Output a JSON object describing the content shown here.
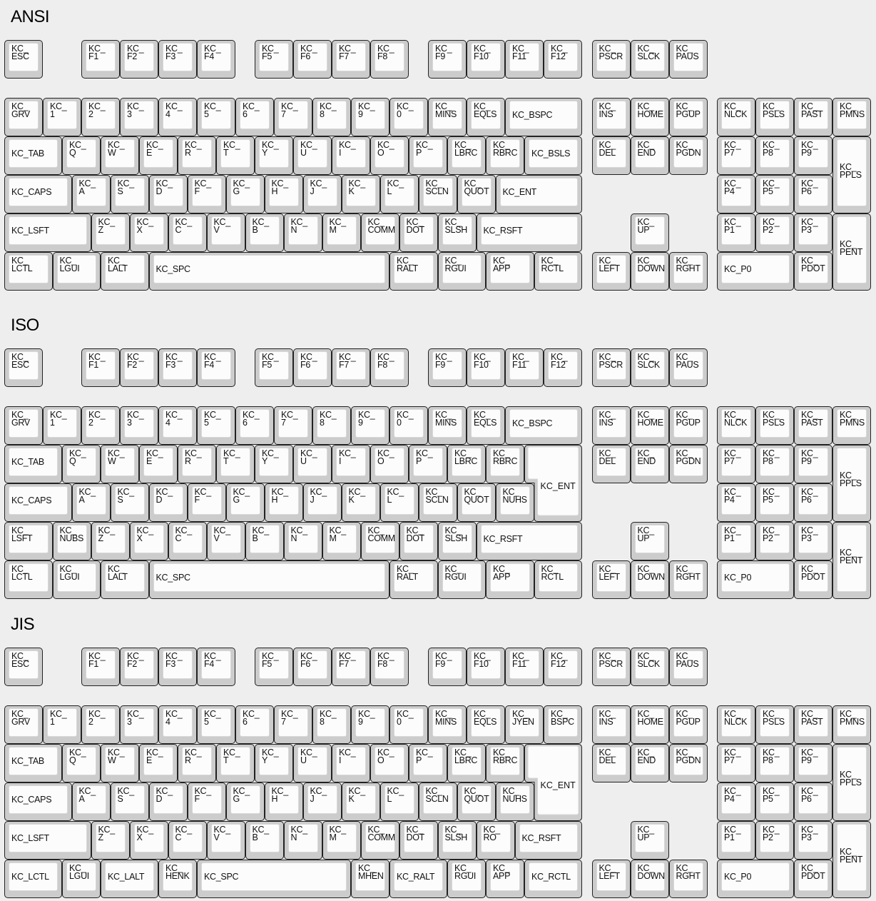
{
  "sections": [
    {
      "title": "ANSI",
      "layout": "ansi",
      "frow": [
        "KC_ESC",
        "KC_F1",
        "KC_F2",
        "KC_F3",
        "KC_F4",
        "KC_F5",
        "KC_F6",
        "KC_F7",
        "KC_F8",
        "KC_F9",
        "KC_F10",
        "KC_F11",
        "KC_F12",
        "KC_PSCR",
        "KC_SLCK",
        "KC_PAUS"
      ],
      "main": [
        [
          "KC_GRV",
          "KC_1",
          "KC_2",
          "KC_3",
          "KC_4",
          "KC_5",
          "KC_6",
          "KC_7",
          "KC_8",
          "KC_9",
          "KC_0",
          "KC_MINS",
          "KC_EQLS",
          "KC_BSPC"
        ],
        [
          "KC_TAB",
          "KC_Q",
          "KC_W",
          "KC_E",
          "KC_R",
          "KC_T",
          "KC_Y",
          "KC_U",
          "KC_I",
          "KC_O",
          "KC_P",
          "KC_LBRC",
          "KC_RBRC",
          "KC_BSLS"
        ],
        [
          "KC_CAPS",
          "KC_A",
          "KC_S",
          "KC_D",
          "KC_F",
          "KC_G",
          "KC_H",
          "KC_J",
          "KC_K",
          "KC_L",
          "KC_SCLN",
          "KC_QUOT",
          "KC_ENT"
        ],
        [
          "KC_LSFT",
          "KC_Z",
          "KC_X",
          "KC_C",
          "KC_V",
          "KC_B",
          "KC_N",
          "KC_M",
          "KC_COMM",
          "KC_DOT",
          "KC_SLSH",
          "KC_RSFT"
        ],
        [
          "KC_LCTL",
          "KC_LGUI",
          "KC_LALT",
          "KC_SPC",
          "KC_RALT",
          "KC_RGUI",
          "KC_APP",
          "KC_RCTL"
        ]
      ],
      "nav": [
        "KC_INS",
        "KC_HOME",
        "KC_PGUP",
        "KC_DEL",
        "KC_END",
        "KC_PGDN",
        "KC_UP",
        "KC_LEFT",
        "KC_DOWN",
        "KC_RGHT"
      ],
      "numpad": [
        "KC_NLCK",
        "KC_PSLS",
        "KC_PAST",
        "KC_PMNS",
        "KC_P7",
        "KC_P8",
        "KC_P9",
        "KC_PPLS",
        "KC_P4",
        "KC_P5",
        "KC_P6",
        "KC_P1",
        "KC_P2",
        "KC_P3",
        "KC_PENT",
        "KC_P0",
        "KC_PDOT"
      ]
    },
    {
      "title": "ISO",
      "layout": "iso",
      "frow": [
        "KC_ESC",
        "KC_F1",
        "KC_F2",
        "KC_F3",
        "KC_F4",
        "KC_F5",
        "KC_F6",
        "KC_F7",
        "KC_F8",
        "KC_F9",
        "KC_F10",
        "KC_F11",
        "KC_F12",
        "KC_PSCR",
        "KC_SLCK",
        "KC_PAUS"
      ],
      "main": [
        [
          "KC_GRV",
          "KC_1",
          "KC_2",
          "KC_3",
          "KC_4",
          "KC_5",
          "KC_6",
          "KC_7",
          "KC_8",
          "KC_9",
          "KC_0",
          "KC_MINS",
          "KC_EQLS",
          "KC_BSPC"
        ],
        [
          "KC_TAB",
          "KC_Q",
          "KC_W",
          "KC_E",
          "KC_R",
          "KC_T",
          "KC_Y",
          "KC_U",
          "KC_I",
          "KC_O",
          "KC_P",
          "KC_LBRC",
          "KC_RBRC",
          "KC_ENT"
        ],
        [
          "KC_CAPS",
          "KC_A",
          "KC_S",
          "KC_D",
          "KC_F",
          "KC_G",
          "KC_H",
          "KC_J",
          "KC_K",
          "KC_L",
          "KC_SCLN",
          "KC_QUOT",
          "KC_NUHS"
        ],
        [
          "KC_LSFT",
          "KC_NUBS",
          "KC_Z",
          "KC_X",
          "KC_C",
          "KC_V",
          "KC_B",
          "KC_N",
          "KC_M",
          "KC_COMM",
          "KC_DOT",
          "KC_SLSH",
          "KC_RSFT"
        ],
        [
          "KC_LCTL",
          "KC_LGUI",
          "KC_LALT",
          "KC_SPC",
          "KC_RALT",
          "KC_RGUI",
          "KC_APP",
          "KC_RCTL"
        ]
      ],
      "nav": [
        "KC_INS",
        "KC_HOME",
        "KC_PGUP",
        "KC_DEL",
        "KC_END",
        "KC_PGDN",
        "KC_UP",
        "KC_LEFT",
        "KC_DOWN",
        "KC_RGHT"
      ],
      "numpad": [
        "KC_NLCK",
        "KC_PSLS",
        "KC_PAST",
        "KC_PMNS",
        "KC_P7",
        "KC_P8",
        "KC_P9",
        "KC_PPLS",
        "KC_P4",
        "KC_P5",
        "KC_P6",
        "KC_P1",
        "KC_P2",
        "KC_P3",
        "KC_PENT",
        "KC_P0",
        "KC_PDOT"
      ]
    },
    {
      "title": "JIS",
      "layout": "jis",
      "frow": [
        "KC_ESC",
        "KC_F1",
        "KC_F2",
        "KC_F3",
        "KC_F4",
        "KC_F5",
        "KC_F6",
        "KC_F7",
        "KC_F8",
        "KC_F9",
        "KC_F10",
        "KC_F11",
        "KC_F12",
        "KC_PSCR",
        "KC_SLCK",
        "KC_PAUS"
      ],
      "main": [
        [
          "KC_GRV",
          "KC_1",
          "KC_2",
          "KC_3",
          "KC_4",
          "KC_5",
          "KC_6",
          "KC_7",
          "KC_8",
          "KC_9",
          "KC_0",
          "KC_MINS",
          "KC_EQLS",
          "KC_JYEN",
          "KC_BSPC"
        ],
        [
          "KC_TAB",
          "KC_Q",
          "KC_W",
          "KC_E",
          "KC_R",
          "KC_T",
          "KC_Y",
          "KC_U",
          "KC_I",
          "KC_O",
          "KC_P",
          "KC_LBRC",
          "KC_RBRC",
          "KC_ENT"
        ],
        [
          "KC_CAPS",
          "KC_A",
          "KC_S",
          "KC_D",
          "KC_F",
          "KC_G",
          "KC_H",
          "KC_J",
          "KC_K",
          "KC_L",
          "KC_SCLN",
          "KC_QUOT",
          "KC_NUHS"
        ],
        [
          "KC_LSFT",
          "KC_Z",
          "KC_X",
          "KC_C",
          "KC_V",
          "KC_B",
          "KC_N",
          "KC_M",
          "KC_COMM",
          "KC_DOT",
          "KC_SLSH",
          "KC_RO",
          "KC_RSFT"
        ],
        [
          "KC_LCTL",
          "KC_LGUI",
          "KC_LALT",
          "KC_HENK",
          "KC_SPC",
          "KC_MHEN",
          "KC_RALT",
          "KC_RGUI",
          "KC_APP",
          "KC_RCTL"
        ]
      ],
      "nav": [
        "KC_INS",
        "KC_HOME",
        "KC_PGUP",
        "KC_DEL",
        "KC_END",
        "KC_PGDN",
        "KC_UP",
        "KC_LEFT",
        "KC_DOWN",
        "KC_RGHT"
      ],
      "numpad": [
        "KC_NLCK",
        "KC_PSLS",
        "KC_PAST",
        "KC_PMNS",
        "KC_P7",
        "KC_P8",
        "KC_P9",
        "KC_PPLS",
        "KC_P4",
        "KC_P5",
        "KC_P6",
        "KC_P1",
        "KC_P2",
        "KC_P3",
        "KC_PENT",
        "KC_P0",
        "KC_PDOT"
      ]
    }
  ]
}
